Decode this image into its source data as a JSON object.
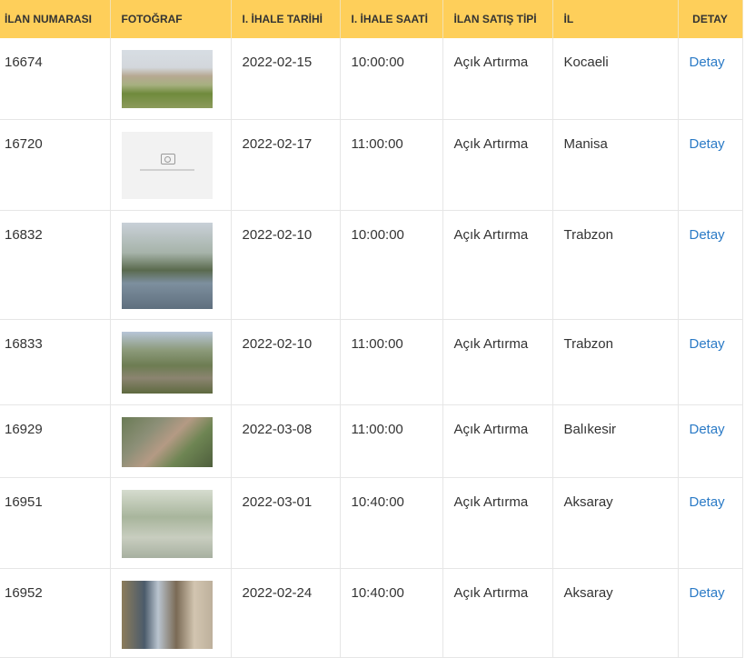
{
  "headers": {
    "ilan_no": "İLAN NUMARASI",
    "foto": "FOTOĞRAF",
    "ihale_tarihi": "I. İHALE TARİHİ",
    "ihale_saati": "I. İHALE SAATİ",
    "satis_tipi": "İLAN SATIŞ TİPİ",
    "il": "İL",
    "detay": "DETAY"
  },
  "rows": [
    {
      "id": "16674",
      "date": "2022-02-15",
      "time": "10:00:00",
      "type": "Açık Artırma",
      "city": "Kocaeli",
      "detail": "Detay"
    },
    {
      "id": "16720",
      "date": "2022-02-17",
      "time": "11:00:00",
      "type": "Açık Artırma",
      "city": "Manisa",
      "detail": "Detay"
    },
    {
      "id": "16832",
      "date": "2022-02-10",
      "time": "10:00:00",
      "type": "Açık Artırma",
      "city": "Trabzon",
      "detail": "Detay"
    },
    {
      "id": "16833",
      "date": "2022-02-10",
      "time": "11:00:00",
      "type": "Açık Artırma",
      "city": "Trabzon",
      "detail": "Detay"
    },
    {
      "id": "16929",
      "date": "2022-03-08",
      "time": "11:00:00",
      "type": "Açık Artırma",
      "city": "Balıkesir",
      "detail": "Detay"
    },
    {
      "id": "16951",
      "date": "2022-03-01",
      "time": "10:40:00",
      "type": "Açık Artırma",
      "city": "Aksaray",
      "detail": "Detay"
    },
    {
      "id": "16952",
      "date": "2022-02-24",
      "time": "10:40:00",
      "type": "Açık Artırma",
      "city": "Aksaray",
      "detail": "Detay"
    }
  ],
  "colors": {
    "header_bg": "#fecf5a",
    "link": "#2a7ac6"
  }
}
